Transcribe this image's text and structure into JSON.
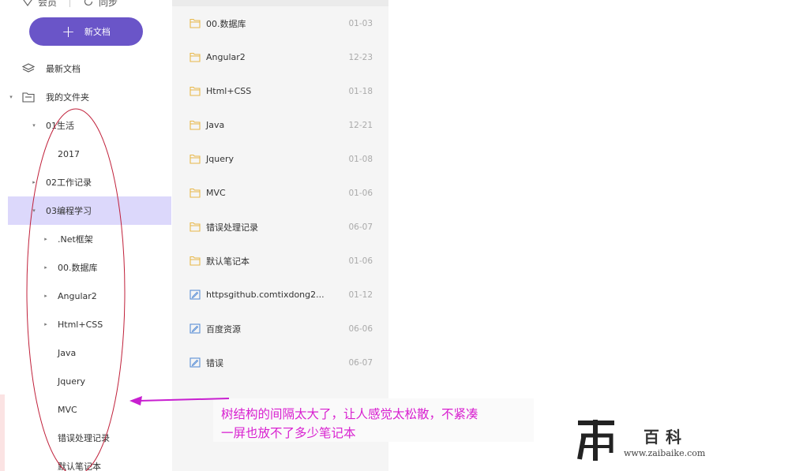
{
  "topbar": {
    "item1": "会员",
    "item2": "同步"
  },
  "new_doc_button": "新文档",
  "tree": [
    {
      "label": "最新文档",
      "icon": "layers-icon",
      "caret": ""
    },
    {
      "label": "我的文件夹",
      "icon": "folder-outline-icon",
      "caret": "▾"
    },
    {
      "label": "01生活",
      "caret": "▾"
    },
    {
      "label": "2017",
      "caret": ""
    },
    {
      "label": "02工作记录",
      "caret": "▸"
    },
    {
      "label": "03编程学习",
      "caret": "▾",
      "selected": true
    },
    {
      "label": ".Net框架",
      "caret": "▸"
    },
    {
      "label": "00.数据库",
      "caret": "▸"
    },
    {
      "label": "Angular2",
      "caret": "▸"
    },
    {
      "label": "Html+CSS",
      "caret": "▸"
    },
    {
      "label": "Java",
      "caret": ""
    },
    {
      "label": "Jquery",
      "caret": ""
    },
    {
      "label": "MVC",
      "caret": ""
    },
    {
      "label": "错误处理记录",
      "caret": ""
    },
    {
      "label": "默认笔记本",
      "caret": ""
    }
  ],
  "list": [
    {
      "name": "00.数据库",
      "date": "01-03",
      "type": "folder"
    },
    {
      "name": "Angular2",
      "date": "12-23",
      "type": "folder"
    },
    {
      "name": "Html+CSS",
      "date": "01-18",
      "type": "folder"
    },
    {
      "name": "Java",
      "date": "12-21",
      "type": "folder"
    },
    {
      "name": "Jquery",
      "date": "01-08",
      "type": "folder"
    },
    {
      "name": "MVC",
      "date": "01-06",
      "type": "folder"
    },
    {
      "name": "错误处理记录",
      "date": "06-07",
      "type": "folder"
    },
    {
      "name": "默认笔记本",
      "date": "01-06",
      "type": "folder"
    },
    {
      "name": "httpsgithub.comtixdong2...",
      "date": "01-12",
      "type": "note"
    },
    {
      "name": "百度资源",
      "date": "06-06",
      "type": "note"
    },
    {
      "name": "错误",
      "date": "06-07",
      "type": "note"
    }
  ],
  "annotation": {
    "line1": "树结构的间隔太大了，让人感觉太松散，不紧凑",
    "line2": "一屏也放不了多少笔记本",
    "color": "#d81fd0"
  },
  "watermark": {
    "brand": "百科",
    "url": "www.zaibaike.com"
  },
  "colors": {
    "accent": "#6a55c8",
    "selected_row": "#dcd8fb",
    "folder_icon": "#e8b84a",
    "note_icon": "#5b8fd6"
  }
}
